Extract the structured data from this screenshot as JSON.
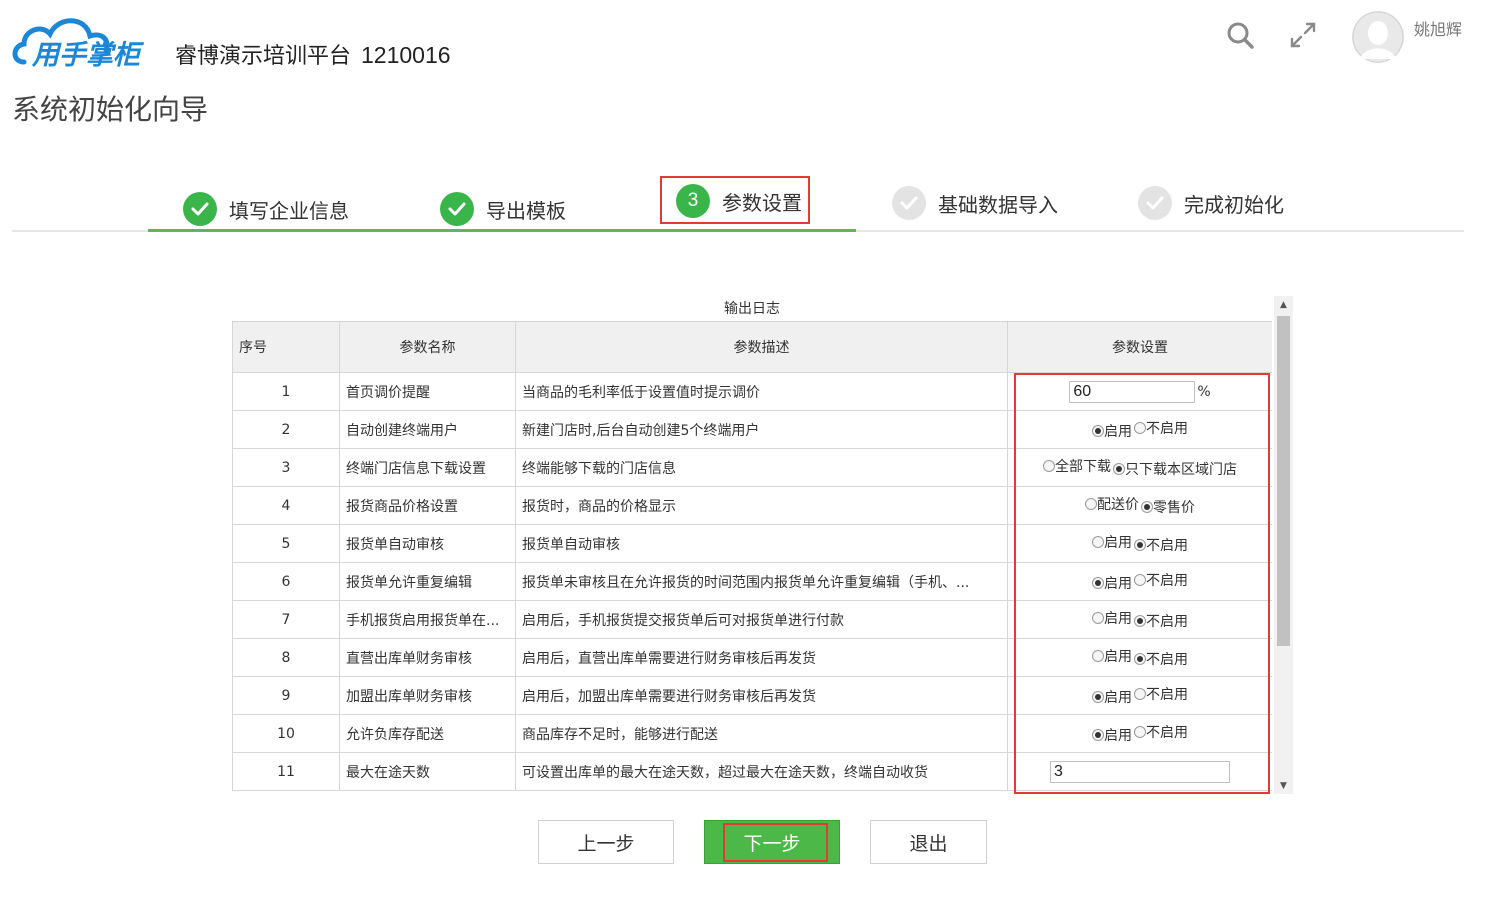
{
  "header": {
    "logo_text": "用手掌柜",
    "company_name": "睿博演示培训平台",
    "company_code": "1210016",
    "search_icon": "search-icon",
    "fullscreen_icon": "fullscreen-icon",
    "user_name": "姚旭辉"
  },
  "page_title": "系统初始化向导",
  "steps": [
    {
      "label": "填写企业信息",
      "state": "done"
    },
    {
      "label": "导出模板",
      "state": "done"
    },
    {
      "label": "参数设置",
      "state": "current",
      "number": "3"
    },
    {
      "label": "基础数据导入",
      "state": "todo"
    },
    {
      "label": "完成初始化",
      "state": "todo"
    }
  ],
  "table": {
    "caption": "输出日志",
    "headers": [
      "序号",
      "参数名称",
      "参数描述",
      "参数设置"
    ],
    "rows": [
      {
        "no": "1",
        "name": "首页调价提醒",
        "desc": "当商品的毛利率低于设置值时提示调价",
        "type": "input",
        "value": "60",
        "unit": "%"
      },
      {
        "no": "2",
        "name": "自动创建终端用户",
        "desc": "新建门店时,后台自动创建5个终端用户",
        "type": "radio",
        "options": [
          "启用",
          "不启用"
        ],
        "selected": 0
      },
      {
        "no": "3",
        "name": "终端门店信息下载设置",
        "desc": "终端能够下载的门店信息",
        "type": "radio",
        "options": [
          "全部下载",
          "只下载本区域门店"
        ],
        "selected": 1
      },
      {
        "no": "4",
        "name": "报货商品价格设置",
        "desc": "报货时，商品的价格显示",
        "type": "radio",
        "options": [
          "配送价",
          "零售价"
        ],
        "selected": 1
      },
      {
        "no": "5",
        "name": "报货单自动审核",
        "desc": "报货单自动审核",
        "type": "radio",
        "options": [
          "启用",
          "不启用"
        ],
        "selected": 1
      },
      {
        "no": "6",
        "name": "报货单允许重复编辑",
        "desc": "报货单未审核且在允许报货的时间范围内报货单允许重复编辑（手机、...",
        "type": "radio",
        "options": [
          "启用",
          "不启用"
        ],
        "selected": 0
      },
      {
        "no": "7",
        "name": "手机报货启用报货单在...",
        "desc": "启用后，手机报货提交报货单后可对报货单进行付款",
        "type": "radio",
        "options": [
          "启用",
          "不启用"
        ],
        "selected": 1
      },
      {
        "no": "8",
        "name": "直营出库单财务审核",
        "desc": "启用后，直营出库单需要进行财务审核后再发货",
        "type": "radio",
        "options": [
          "启用",
          "不启用"
        ],
        "selected": 1
      },
      {
        "no": "9",
        "name": "加盟出库单财务审核",
        "desc": "启用后，加盟出库单需要进行财务审核后再发货",
        "type": "radio",
        "options": [
          "启用",
          "不启用"
        ],
        "selected": 0
      },
      {
        "no": "10",
        "name": "允许负库存配送",
        "desc": "商品库存不足时，能够进行配送",
        "type": "radio",
        "options": [
          "启用",
          "不启用"
        ],
        "selected": 0
      },
      {
        "no": "11",
        "name": "最大在途天数",
        "desc": "可设置出库单的最大在途天数，超过最大在途天数，终端自动收货",
        "type": "input",
        "value": "3",
        "unit": ""
      }
    ]
  },
  "buttons": {
    "prev": "上一步",
    "next": "下一步",
    "exit": "退出"
  },
  "colors": {
    "accent_green": "#3ab54a",
    "highlight_red": "#e53935"
  }
}
